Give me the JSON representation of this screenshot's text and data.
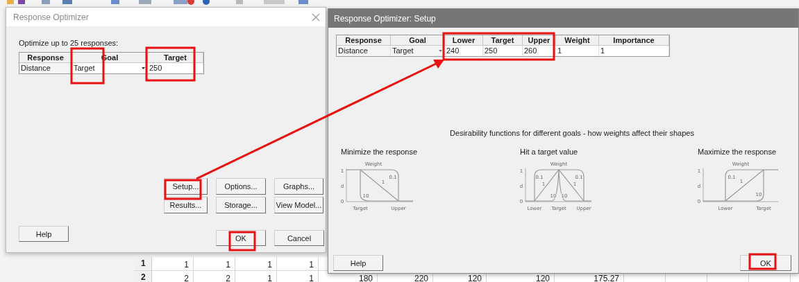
{
  "worksheet": {
    "rows": [
      {
        "number": "1",
        "cells": [
          "1",
          "1",
          "1",
          "1"
        ]
      },
      {
        "number": "2",
        "cells": [
          "2",
          "2",
          "1",
          "1",
          "180",
          "220",
          "120",
          "120",
          "175.27"
        ]
      }
    ]
  },
  "optimizer_dialog": {
    "title": "Response Optimizer",
    "prompt": "Optimize up to 25 responses:",
    "table": {
      "columns": [
        "Response",
        "Goal",
        "Target"
      ],
      "rows": [
        {
          "response": "Distance",
          "goal": "Target",
          "target": "250"
        }
      ]
    },
    "buttons": [
      "Setup...",
      "Options...",
      "Graphs...",
      "Results...",
      "Storage...",
      "View Model..."
    ],
    "help": "Help",
    "ok": "OK",
    "cancel": "Cancel"
  },
  "setup_dialog": {
    "title": "Response Optimizer: Setup",
    "table": {
      "columns": [
        "Response",
        "Goal",
        "Lower",
        "Target",
        "Upper",
        "Weight",
        "Importance"
      ],
      "rows": [
        {
          "response": "Distance",
          "goal": "Target",
          "lower": "240",
          "target": "250",
          "upper": "260",
          "weight": "1",
          "importance": "1"
        }
      ]
    },
    "caption": "Desirability functions for different goals - how weights affect their shapes",
    "diagrams": [
      {
        "kind": "minimize",
        "title": "Minimize the response",
        "top_label": "Weight",
        "y_labels": [
          "1",
          "d",
          "0"
        ],
        "curve_labels": [
          "0.1",
          "1",
          "10"
        ],
        "x_labels": [
          "Target",
          "Upper"
        ]
      },
      {
        "kind": "target",
        "title": "Hit a target value",
        "top_label": "Weight",
        "y_labels": [
          "1",
          "d",
          "0"
        ],
        "curve_labels": [
          "0.1",
          "0.1",
          "1",
          "1",
          "10",
          "10"
        ],
        "x_labels": [
          "Lower",
          "Target",
          "Upper"
        ]
      },
      {
        "kind": "maximize",
        "title": "Maximize the response",
        "top_label": "Weight",
        "y_labels": [
          "1",
          "d",
          "0"
        ],
        "curve_labels": [
          "0.1",
          "1",
          "10"
        ],
        "x_labels": [
          "Lower",
          "Target"
        ]
      }
    ],
    "help": "Help",
    "ok": "OK"
  }
}
